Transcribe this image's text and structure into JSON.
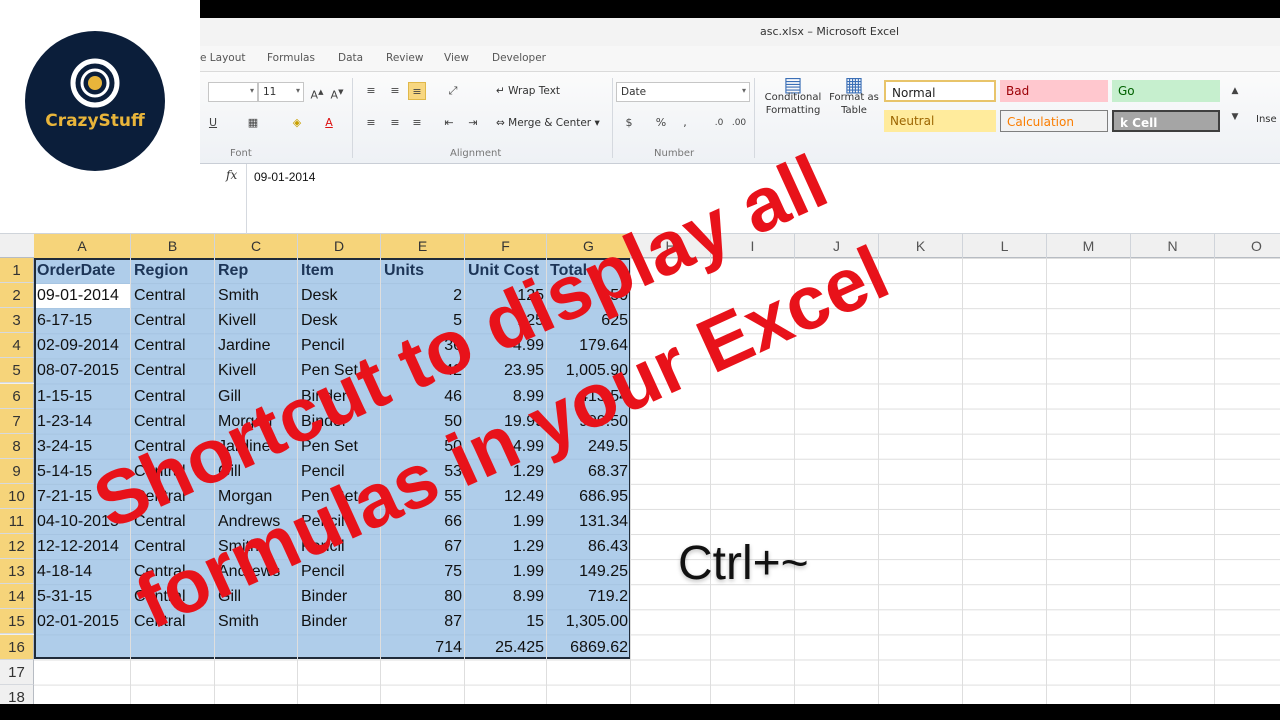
{
  "window": {
    "title": "asc.xlsx  –  Microsoft Excel"
  },
  "menu": [
    {
      "label": "e Layout"
    },
    {
      "label": "Formulas"
    },
    {
      "label": "Data"
    },
    {
      "label": "Review"
    },
    {
      "label": "View"
    },
    {
      "label": "Developer"
    }
  ],
  "ribbon": {
    "font_size": "11",
    "wrap_text": "Wrap Text",
    "merge_center": "Merge & Center",
    "number_format": "Date",
    "conditional_formatting": "Conditional Formatting",
    "format_as_table": "Format as Table",
    "group_font": "Font",
    "group_alignment": "Alignment",
    "group_number": "Number",
    "styles": {
      "normal": "Normal",
      "bad": "Bad",
      "good": "Go",
      "neutral": "Neutral",
      "calculation": "Calculation",
      "check_cell": "k Cell"
    },
    "insert": "Inse"
  },
  "formula_bar": {
    "fx": "fx",
    "value": "09-01-2014"
  },
  "columns": [
    "A",
    "B",
    "C",
    "D",
    "E",
    "F",
    "G",
    "H",
    "I",
    "J",
    "K",
    "L",
    "M",
    "N",
    "O"
  ],
  "rows": [
    "1",
    "2",
    "3",
    "4",
    "5",
    "6",
    "7",
    "8",
    "9",
    "10",
    "11",
    "12",
    "13",
    "14",
    "15",
    "16",
    "17",
    "18"
  ],
  "sheet": {
    "headers": [
      "OrderDate",
      "Region",
      "Rep",
      "Item",
      "Units",
      "Unit Cost",
      "Total"
    ],
    "data": [
      [
        "09-01-2014",
        "Central",
        "Smith",
        "Desk",
        "2",
        "125",
        "250"
      ],
      [
        "6-17-15",
        "Central",
        "Kivell",
        "Desk",
        "5",
        "125",
        "625"
      ],
      [
        "02-09-2014",
        "Central",
        "Jardine",
        "Pencil",
        "36",
        "4.99",
        "179.64"
      ],
      [
        "08-07-2015",
        "Central",
        "Kivell",
        "Pen Set",
        "42",
        "23.95",
        "1,005.90"
      ],
      [
        "1-15-15",
        "Central",
        "Gill",
        "Binder",
        "46",
        "8.99",
        "413.54"
      ],
      [
        "1-23-14",
        "Central",
        "Morgan",
        "Binder",
        "50",
        "19.99",
        "999.50"
      ],
      [
        "3-24-15",
        "Central",
        "Jardine",
        "Pen Set",
        "50",
        "4.99",
        "249.5"
      ],
      [
        "5-14-15",
        "Central",
        "Gill",
        "Pencil",
        "53",
        "1.29",
        "68.37"
      ],
      [
        "7-21-15",
        "Central",
        "Morgan",
        "Pen Set",
        "55",
        "12.49",
        "686.95"
      ],
      [
        "04-10-2015",
        "Central",
        "Andrews",
        "Pencil",
        "66",
        "1.99",
        "131.34"
      ],
      [
        "12-12-2014",
        "Central",
        "Smith",
        "Pencil",
        "67",
        "1.29",
        "86.43"
      ],
      [
        "4-18-14",
        "Central",
        "Andrews",
        "Pencil",
        "75",
        "1.99",
        "149.25"
      ],
      [
        "5-31-15",
        "Central",
        "Gill",
        "Binder",
        "80",
        "8.99",
        "719.2"
      ],
      [
        "02-01-2015",
        "Central",
        "Smith",
        "Binder",
        "87",
        "15",
        "1,305.00"
      ]
    ],
    "totals": [
      "",
      "",
      "",
      "",
      "714",
      "25.425",
      "6869.62"
    ]
  },
  "shortcut": "Ctrl+~",
  "logo": {
    "text": "CrazyStuff"
  },
  "banner": {
    "line1": "Shortcut to display all",
    "line2": "formulas in your Excel"
  },
  "colors": {
    "banner": "#e8121a",
    "selection": "#90bae2",
    "header_highlight": "#f6d47a",
    "logo_bg": "#0b1e3a",
    "logo_text": "#e9b53a"
  }
}
